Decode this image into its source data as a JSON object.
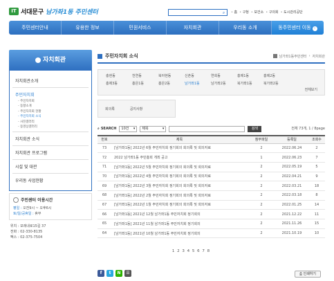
{
  "header": {
    "logo_mark": "IT",
    "logo_name": "서대문구",
    "logo_sub": "남가좌1동 주민센터",
    "util_links": [
      "홈",
      "구청",
      "보건소",
      "구의회",
      "도시관리공단"
    ]
  },
  "gnb": [
    "주민센터안내",
    "유용한 정보",
    "민원서비스",
    "자치회관",
    "우리동 소개",
    "동주민센터 이동"
  ],
  "lnb": {
    "title": "자치회관",
    "items": [
      "자치회관소개",
      "주민자치회"
    ],
    "sub": [
      "주민자치회",
      "동향소개",
      "주민자치회 현황",
      "주민자치회 소식",
      "사진갤러리",
      "동영상갤러리"
    ],
    "items2": [
      "자치회관 소식",
      "자치회관 프로그램",
      "시설 및 대관",
      "우리동 사업현황"
    ]
  },
  "hours": {
    "title": "주민센터 이용시간",
    "line1_label": "평일 :",
    "line1": "오전9시 ~ 오후6시",
    "line2_label": "토/일/공휴일 :",
    "line2": "휴무"
  },
  "contact": [
    "위치 : 모래내로15길 37",
    "전화 : 02-330-8135",
    "팩스 : 02-375-7504"
  ],
  "main": {
    "title": "주민자치회 소식",
    "breadcrumb": [
      "남가좌1동주민센터",
      "자치회관"
    ],
    "dongs": [
      "충현동",
      "천연동",
      "북아현동",
      "신촌동",
      "연희동",
      "홍제1동",
      "홍제2동",
      "홍제3동",
      "홍은1동",
      "홍은2동",
      "남가좌1동",
      "남가좌2동",
      "북가좌1동",
      "북가좌2동"
    ],
    "current_dong": "남가좌1동",
    "more": "전체보기",
    "tabs": [
      "회의록",
      "공지사항"
    ]
  },
  "search": {
    "label": "SEARCH",
    "count_select": "10건",
    "field_select": "제목",
    "button": "검색",
    "total": "전체 73개, 1 / 8page"
  },
  "table": {
    "headers": [
      "번호",
      "제목",
      "첨부파일",
      "등록일",
      "조회수"
    ],
    "rows": [
      [
        "73",
        "[남가좌1동] 2022년 6월 주민자치회 정기회의 회의록 및 회의자료",
        "2",
        "2022.06.24",
        "2"
      ],
      [
        "72",
        "2022 남가좌1동 주민총회 개최 공고",
        "1",
        "2022.06.23",
        "7"
      ],
      [
        "71",
        "[남가좌1동] 2022년 5월 주민자치회 정기회의 회의록 및 회의자료",
        "2",
        "2022.05.19",
        "5"
      ],
      [
        "70",
        "[남가좌1동] 2022년 4월 주민자치회 정기회의 회의록 및 회의자료",
        "2",
        "2022.04.21",
        "9"
      ],
      [
        "69",
        "[남가좌1동] 2022년 3월 주민자치회 정기회의 회의록 및 회의자료",
        "2",
        "2022.03.21",
        "18"
      ],
      [
        "68",
        "[남가좌1동] 2022년 2월 주민자치회 정기회의 회의록 및 회의자료",
        "2",
        "2022.03.18",
        "8"
      ],
      [
        "67",
        "[남가좌1동] 2022년 1월 주민자치회 정기회의 회의록 및 회의자료",
        "2",
        "2022.01.25",
        "14"
      ],
      [
        "66",
        "[남가좌1동] 2021년 12월 남가좌1동 주민자치회 정기회의",
        "2",
        "2021.12.22",
        "11"
      ],
      [
        "65",
        "[남가좌1동] 2021년 11월 남가좌1동 주민자치회 정기회의",
        "2",
        "2021.11.26",
        "15"
      ],
      [
        "64",
        "[남가좌1동] 2021년 10월 남가좌1동 주민자치회 정기회의",
        "2",
        "2021.10.19",
        "10"
      ]
    ]
  },
  "pager": "1 2 3 4 5 6 7 8",
  "footer": {
    "share_icons": [
      "f",
      "t",
      "N",
      "☰"
    ],
    "print": "인쇄하기"
  },
  "colors": {
    "accent": "#2e6fc0",
    "brand_green": "#2f9a3e",
    "link": "#2a7fd0"
  }
}
